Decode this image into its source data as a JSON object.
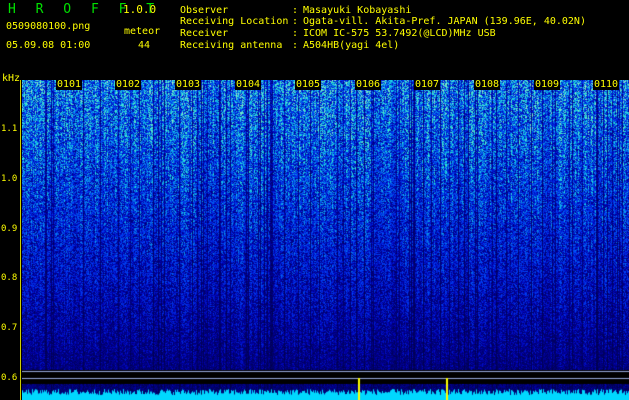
{
  "header": {
    "app_title": "H R O F F T",
    "version": "1.0.0",
    "file_name": "0509080100.png",
    "datetime": "05.09.08 01:00",
    "meteor_label": "meteor",
    "meteor_count": "44"
  },
  "info": [
    {
      "key": "Observer",
      "sep": ":",
      "value": "Masayuki Kobayashi"
    },
    {
      "key": "Receiving Location",
      "sep": ":",
      "value": "Ogata-vill. Akita-Pref. JAPAN (139.96E, 40.02N)"
    },
    {
      "key": "Receiver",
      "sep": ":",
      "value": "ICOM IC-575 53.7492(@LCD)MHz USB"
    },
    {
      "key": "Receiving antenna",
      "sep": ":",
      "value": "A504HB(yagi 4el)"
    }
  ],
  "axis": {
    "y_unit": "kHz",
    "y_ticks": [
      "1.1",
      "1.0",
      "0.9",
      "0.8",
      "0.7",
      "0.6"
    ],
    "x_ticks": [
      "0101",
      "0102",
      "0103",
      "0104",
      "0105",
      "0106",
      "0107",
      "0108",
      "0109",
      "0110"
    ]
  },
  "colors": {
    "text": "#ffff00",
    "title": "#00e000",
    "background": "#000000"
  }
}
